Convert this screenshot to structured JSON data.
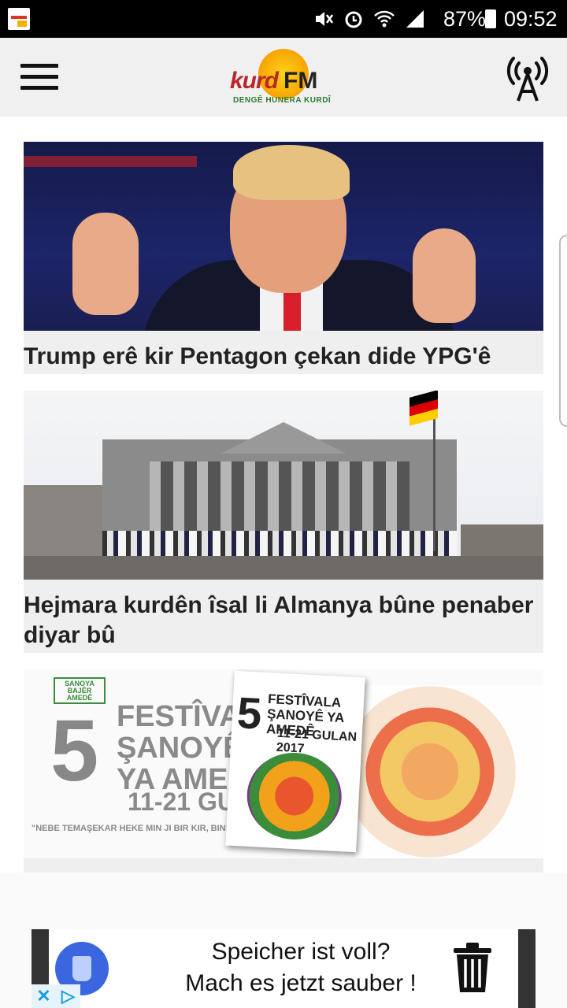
{
  "status_bar": {
    "battery": "87%",
    "time": "09:52"
  },
  "header": {
    "logo_word1": "kurd",
    "logo_word2": "FM",
    "logo_tagline": "DENGÊ HUNERA KURDÎ"
  },
  "articles": [
    {
      "title": "Trump erê kir Pentagon çekan dide YPG'ê"
    },
    {
      "title": "Hejmara kurdên îsal li Almanya bûne penaber diyar bû"
    },
    {
      "title": ""
    }
  ],
  "festival_image": {
    "number": "5",
    "title_lines": [
      "FESTÎVA",
      "ŞANOYÊ",
      "YA AMEI"
    ],
    "date": "11-21 GULAN 2017",
    "tagline": "\"NEBE TEMAŞEKAR HEKE MIN JI BIR KIR, BINE BIRA MIN\"",
    "logo_text": "SANOYA BAJÊR AMEDÊ",
    "poster_title": "FESTÎVALA ŞANOYÊ YA AMEDÊ",
    "poster_date": "11-21 GULAN 2017"
  },
  "ad": {
    "line1": "Speicher ist voll?",
    "line2": "Mach es jetzt sauber !",
    "badge_close": "✕",
    "badge_info": "▷"
  },
  "colors": {
    "logo_red": "#b9262b",
    "logo_sun": "#f7a400",
    "accent_green": "#2c7a2c",
    "card_bg": "#efefef"
  }
}
